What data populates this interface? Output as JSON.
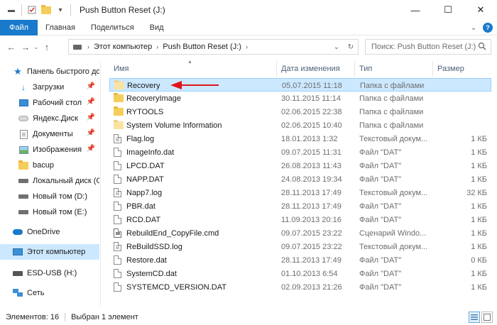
{
  "window": {
    "title": "Push Button Reset (J:)",
    "controls": {
      "minimize": "—",
      "maximize": "☐",
      "close": "✕"
    }
  },
  "ribbon": {
    "tabs": [
      "Файл",
      "Главная",
      "Поделиться",
      "Вид"
    ]
  },
  "address": {
    "crumbs": [
      "Этот компьютер",
      "Push Button Reset (J:)"
    ],
    "search_placeholder": "Поиск: Push Button Reset (J:)"
  },
  "sidebar": {
    "items": [
      {
        "label": "Панель быстрого до",
        "icon": "star-icon",
        "pinned": false
      },
      {
        "label": "Загрузки",
        "icon": "download-icon",
        "pinned": true
      },
      {
        "label": "Рабочий стол",
        "icon": "desktop-icon",
        "pinned": true
      },
      {
        "label": "Яндекс.Диск",
        "icon": "yandex-disk-icon",
        "pinned": true
      },
      {
        "label": "Документы",
        "icon": "documents-icon",
        "pinned": true
      },
      {
        "label": "Изображения",
        "icon": "pictures-icon",
        "pinned": true
      },
      {
        "label": "bacup",
        "icon": "folder-icon",
        "pinned": false
      },
      {
        "label": "Локальный диск (С",
        "icon": "drive-icon",
        "pinned": false
      },
      {
        "label": "Новый том (D:)",
        "icon": "drive-icon",
        "pinned": false
      },
      {
        "label": "Новый том (E:)",
        "icon": "drive-icon",
        "pinned": false
      },
      {
        "label": "OneDrive",
        "icon": "onedrive-icon",
        "pinned": false
      },
      {
        "label": "Этот компьютер",
        "icon": "computer-icon",
        "pinned": false,
        "selected": true
      },
      {
        "label": "ESD-USB (H:)",
        "icon": "usb-drive-icon",
        "pinned": false
      },
      {
        "label": "Сеть",
        "icon": "network-icon",
        "pinned": false
      }
    ]
  },
  "columns": {
    "name": "Имя",
    "date": "Дата изменения",
    "type": "Тип",
    "size": "Размер"
  },
  "files": [
    {
      "name": "Recovery",
      "date": "05.07.2015 11:18",
      "type": "Папка с файлами",
      "size": "",
      "kind": "folder-faded",
      "selected": true
    },
    {
      "name": "RecoveryImage",
      "date": "30.11.2015 11:14",
      "type": "Папка с файлами",
      "size": "",
      "kind": "folder"
    },
    {
      "name": "RYTOOLS",
      "date": "02.06.2015 22:38",
      "type": "Папка с файлами",
      "size": "",
      "kind": "folder"
    },
    {
      "name": "System Volume Information",
      "date": "02.06.2015 10:40",
      "type": "Папка с файлами",
      "size": "",
      "kind": "folder-faded"
    },
    {
      "name": "Flag.log",
      "date": "18.01.2013 1:32",
      "type": "Текстовый докум...",
      "size": "1 КБ",
      "kind": "txt"
    },
    {
      "name": "ImageInfo.dat",
      "date": "09.07.2015 11:31",
      "type": "Файл \"DAT\"",
      "size": "1 КБ",
      "kind": "file"
    },
    {
      "name": "LPCD.DAT",
      "date": "26.08.2013 11:43",
      "type": "Файл \"DAT\"",
      "size": "1 КБ",
      "kind": "file"
    },
    {
      "name": "NAPP.DAT",
      "date": "24.08.2013 19:34",
      "type": "Файл \"DAT\"",
      "size": "1 КБ",
      "kind": "file"
    },
    {
      "name": "Napp7.log",
      "date": "28.11.2013 17:49",
      "type": "Текстовый докум...",
      "size": "32 КБ",
      "kind": "txt"
    },
    {
      "name": "PBR.dat",
      "date": "28.11.2013 17:49",
      "type": "Файл \"DAT\"",
      "size": "1 КБ",
      "kind": "file"
    },
    {
      "name": "RCD.DAT",
      "date": "11.09.2013 20:16",
      "type": "Файл \"DAT\"",
      "size": "1 КБ",
      "kind": "file"
    },
    {
      "name": "RebuildEnd_CopyFile.cmd",
      "date": "09.07.2015 23:22",
      "type": "Сценарий Windo...",
      "size": "1 КБ",
      "kind": "cmd"
    },
    {
      "name": "ReBuildSSD.log",
      "date": "09.07.2015 23:22",
      "type": "Текстовый докум...",
      "size": "1 КБ",
      "kind": "txt"
    },
    {
      "name": "Restore.dat",
      "date": "28.11.2013 17:49",
      "type": "Файл \"DAT\"",
      "size": "0 КБ",
      "kind": "file"
    },
    {
      "name": "SystemCD.dat",
      "date": "01.10.2013 6:54",
      "type": "Файл \"DAT\"",
      "size": "1 КБ",
      "kind": "file"
    },
    {
      "name": "SYSTEMCD_VERSION.DAT",
      "date": "02.09.2013 21:26",
      "type": "Файл \"DAT\"",
      "size": "1 КБ",
      "kind": "file"
    }
  ],
  "status": {
    "count": "Элементов: 16",
    "selected": "Выбран 1 элемент"
  },
  "colors": {
    "accent": "#1979ca",
    "selection": "#cce8ff",
    "annotation_arrow": "#e0141e"
  }
}
